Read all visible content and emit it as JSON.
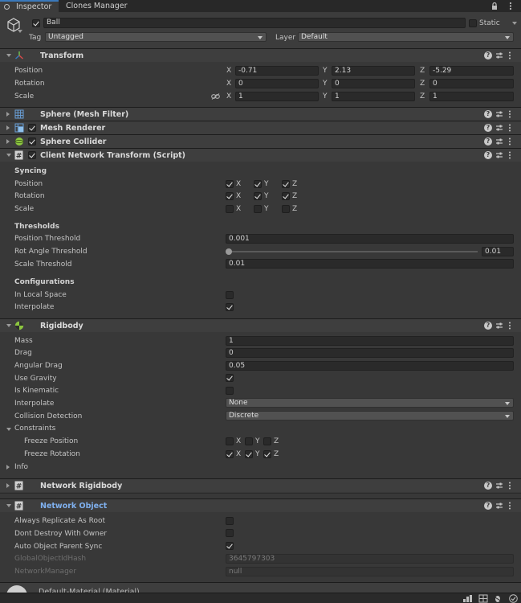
{
  "tabs": {
    "inspector": "Inspector",
    "clones": "Clones Manager"
  },
  "gameobject": {
    "name": "Ball",
    "static_label": "Static",
    "tag_label": "Tag",
    "tag_value": "Untagged",
    "layer_label": "Layer",
    "layer_value": "Default"
  },
  "transform": {
    "title": "Transform",
    "position_label": "Position",
    "rotation_label": "Rotation",
    "scale_label": "Scale",
    "axis_x": "X",
    "axis_y": "Y",
    "axis_z": "Z",
    "position": {
      "x": "-0.71",
      "y": "2.13",
      "z": "-5.29"
    },
    "rotation": {
      "x": "0",
      "y": "0",
      "z": "0"
    },
    "scale": {
      "x": "1",
      "y": "1",
      "z": "1"
    }
  },
  "components": {
    "mesh_filter": "Sphere (Mesh Filter)",
    "mesh_renderer": "Mesh Renderer",
    "sphere_collider": "Sphere Collider",
    "cnt": "Client Network Transform (Script)",
    "rigidbody": "Rigidbody",
    "network_rigidbody": "Network Rigidbody",
    "network_object": "Network Object",
    "material": "Default-Material (Material)"
  },
  "cnt": {
    "syncing": "Syncing",
    "position": "Position",
    "rotation": "Rotation",
    "scale": "Scale",
    "thresholds": "Thresholds",
    "pos_threshold_label": "Position Threshold",
    "pos_threshold": "0.001",
    "rot_threshold_label": "Rot Angle Threshold",
    "rot_threshold": "0.01",
    "scale_threshold_label": "Scale Threshold",
    "scale_threshold": "0.01",
    "configurations": "Configurations",
    "local_space": "In Local Space",
    "interpolate": "Interpolate"
  },
  "rigidbody": {
    "mass_label": "Mass",
    "mass": "1",
    "drag_label": "Drag",
    "drag": "0",
    "angular_drag_label": "Angular Drag",
    "angular_drag": "0.05",
    "use_gravity": "Use Gravity",
    "is_kinematic": "Is Kinematic",
    "interpolate_label": "Interpolate",
    "interpolate": "None",
    "collision_label": "Collision Detection",
    "collision": "Discrete",
    "constraints": "Constraints",
    "freeze_position": "Freeze Position",
    "freeze_rotation": "Freeze Rotation",
    "info": "Info"
  },
  "netobj": {
    "always_replicate": "Always Replicate As Root",
    "dont_destroy": "Dont Destroy With Owner",
    "auto_parent": "Auto Object Parent Sync",
    "hash_label": "GlobalObjectIdHash",
    "hash": "3645797303",
    "manager_label": "NetworkManager",
    "manager": "null"
  },
  "colors": {
    "accent": "#3a79bb",
    "netobj_title": "#7fb0ee",
    "panel": "#383838"
  }
}
